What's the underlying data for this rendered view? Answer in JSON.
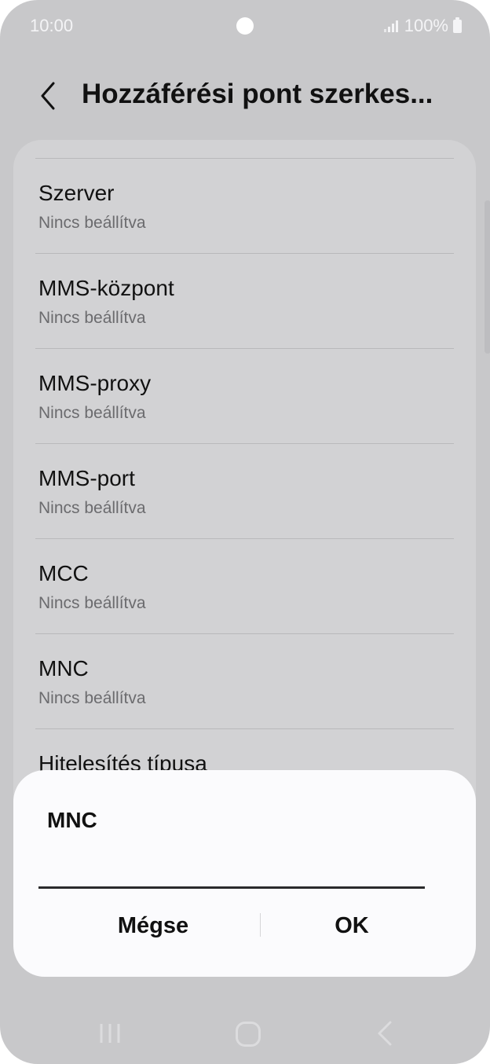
{
  "status_bar": {
    "time": "10:00",
    "battery": "100%"
  },
  "header": {
    "title": "Hozzáférési pont szerkes..."
  },
  "settings_list": [
    {
      "title": "Szerver",
      "value": "Nincs beállítva"
    },
    {
      "title": "MMS-központ",
      "value": "Nincs beállítva"
    },
    {
      "title": "MMS-proxy",
      "value": "Nincs beállítva"
    },
    {
      "title": "MMS-port",
      "value": "Nincs beállítva"
    },
    {
      "title": "MCC",
      "value": "Nincs beállítva"
    },
    {
      "title": "MNC",
      "value": "Nincs beállítva"
    },
    {
      "title": "Hitelesítés típusa",
      "value": ""
    }
  ],
  "dialog": {
    "title": "MNC",
    "input_value": "",
    "cancel_label": "Mégse",
    "ok_label": "OK"
  },
  "icons": {
    "back": "chevron-left-icon",
    "recent_apps": "recent-apps-icon",
    "home": "home-icon",
    "nav_back": "nav-back-icon"
  },
  "colors": {
    "background": "#c8c8ca",
    "card": "#d2d2d4",
    "dialog": "#fbfbfd",
    "text_primary": "#111111",
    "text_secondary": "#6b6b6e"
  }
}
